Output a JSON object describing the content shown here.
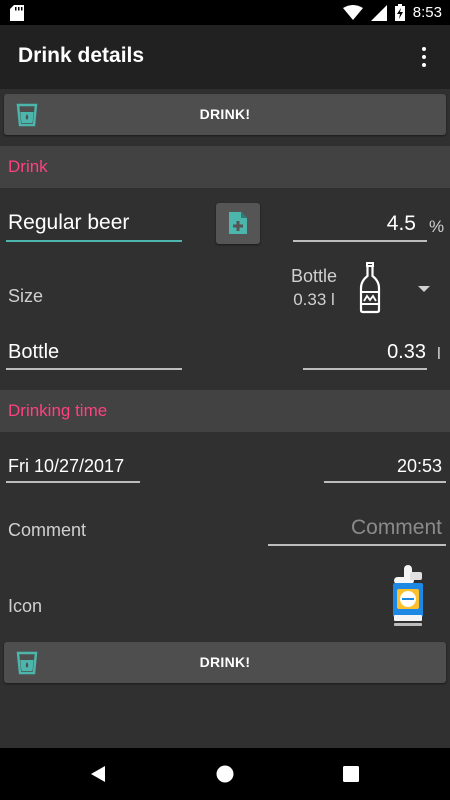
{
  "status_bar": {
    "time": "8:53",
    "battery_icon": "battery-charging-icon",
    "wifi_icon": "wifi-icon",
    "signal_icon": "cell-signal-icon",
    "sd_icon": "sd-card-icon"
  },
  "app_bar": {
    "title": "Drink details",
    "menu_icon": "more-vert-icon"
  },
  "drink_button_top": {
    "label": "DRINK!",
    "icon": "glass-icon",
    "icon_color": "#4db6ac"
  },
  "drink_section": {
    "header": "Drink",
    "name_value": "Regular beer",
    "add_icon": "add-document-icon",
    "percentage_value": "4.5",
    "percentage_unit": "%",
    "size_label": "Size",
    "size_selected_name": "Bottle",
    "size_selected_volume": "0.33 l",
    "size_icon": "beer-bottle-icon",
    "size_name_value": "Bottle",
    "size_volume_value": "0.33",
    "size_volume_unit": "l"
  },
  "drinking_time_section": {
    "header": "Drinking time",
    "date_value": "Fri 10/27/2017",
    "time_value": "20:53",
    "comment_label": "Comment",
    "comment_placeholder": "Comment",
    "icon_label": "Icon",
    "icon_name": "beer-tap-icon"
  },
  "drink_button_bottom": {
    "label": "DRINK!",
    "icon": "glass-icon"
  },
  "nav_bar": {
    "back_icon": "back-triangle-icon",
    "home_icon": "home-circle-icon",
    "recents_icon": "recents-square-icon"
  },
  "colors": {
    "accent": "#ff4081",
    "teal": "#4db6ac",
    "background": "#303030",
    "app_bar": "#212121",
    "section_header": "#424242"
  }
}
